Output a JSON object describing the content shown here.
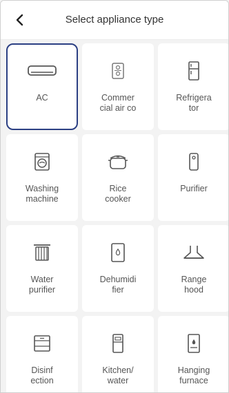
{
  "header": {
    "title": "Select appliance type"
  },
  "tiles": [
    {
      "label": "AC",
      "icon": "air-conditioner-icon",
      "selected": true
    },
    {
      "label": "Commer\ncial air co",
      "icon": "commercial-air-conditioner-icon"
    },
    {
      "label": "Refrigera\ntor",
      "icon": "refrigerator-icon"
    },
    {
      "label": "Washing\nmachine",
      "icon": "washing-machine-icon"
    },
    {
      "label": "Rice\ncooker",
      "icon": "rice-cooker-icon"
    },
    {
      "label": "Purifier",
      "icon": "purifier-icon"
    },
    {
      "label": "Water\npurifier",
      "icon": "water-purifier-icon"
    },
    {
      "label": "Dehumidi\nfier",
      "icon": "dehumidifier-icon"
    },
    {
      "label": "Range\nhood",
      "icon": "range-hood-icon"
    },
    {
      "label": "Disinf\nection",
      "icon": "disinfection-cabinet-icon"
    },
    {
      "label": "Kitchen/\nwater",
      "icon": "kitchen-water-heater-icon"
    },
    {
      "label": "Hanging\nfurnace",
      "icon": "hanging-furnace-icon"
    }
  ],
  "colors": {
    "selected_border": "#2b3f83",
    "background": "#f3f3f3",
    "tile": "#ffffff"
  }
}
